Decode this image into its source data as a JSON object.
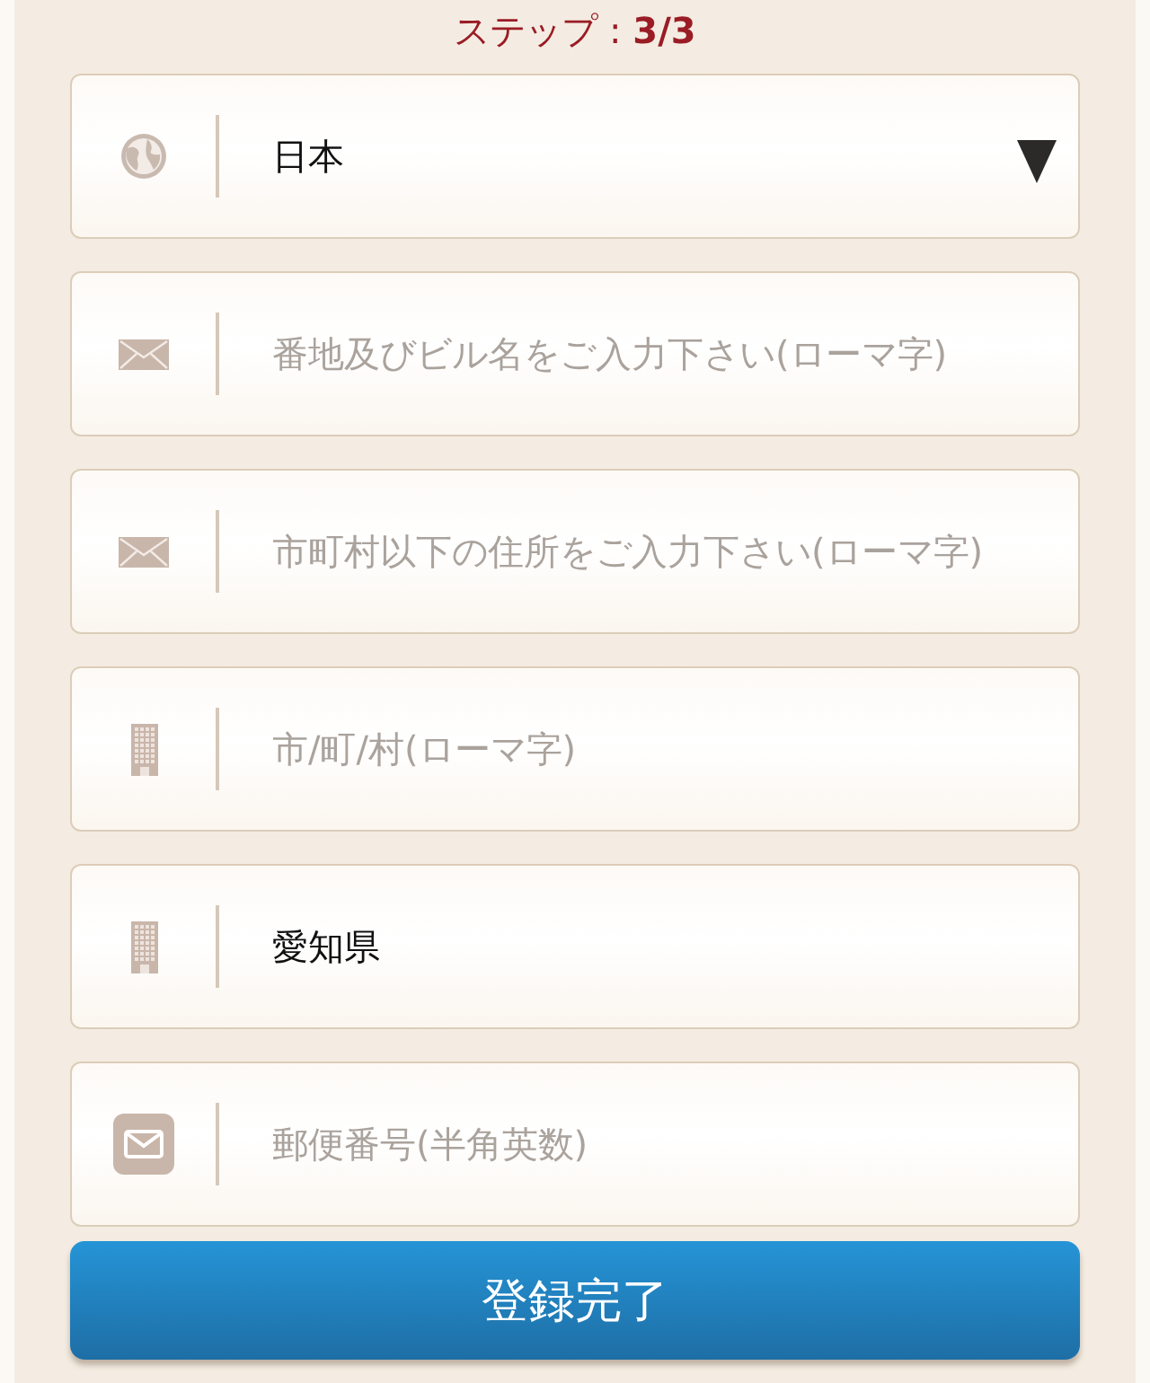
{
  "step": {
    "label": "ステップ : **3/3**"
  },
  "fields": [
    {
      "kind": "select",
      "value": "日本"
    },
    {
      "kind": "input",
      "placeholder": "番地及びビル名をご入力下さい(ローマ字)"
    },
    {
      "kind": "input",
      "placeholder": "市町村以下の住所をご入力下さい(ローマ字)"
    },
    {
      "kind": "input",
      "placeholder": "市/町/村(ローマ字)"
    },
    {
      "kind": "input",
      "value": "愛知県"
    },
    {
      "kind": "input",
      "placeholder": "郵便番号(半角英数)"
    }
  ],
  "submit_button": {
    "label": "登録完了"
  }
}
